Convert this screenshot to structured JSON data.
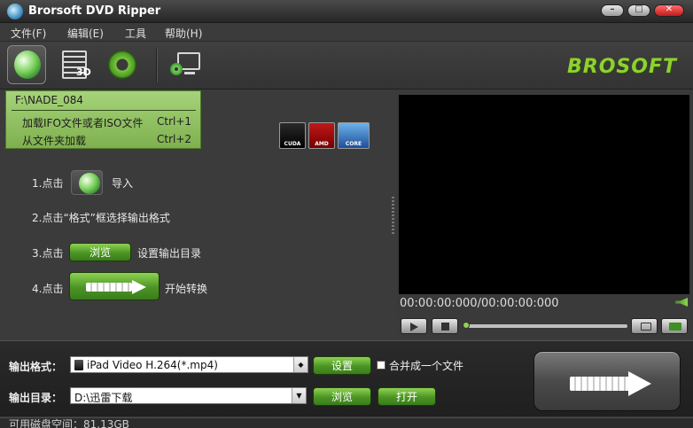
{
  "window": {
    "title": "Brorsoft DVD Ripper",
    "minimize_glyph": "–",
    "maximize_glyph": "□",
    "close_glyph": "✕"
  },
  "menu": {
    "items": [
      "文件(F)",
      "编辑(E)",
      "工具",
      "帮助(H)"
    ]
  },
  "toolbar": {
    "brand_logo_text": "BROSOFT",
    "icons": [
      "load-disc-icon",
      "edit-3d-icon",
      "settings-gear-icon",
      "display-icon"
    ],
    "badge_3d": "3D"
  },
  "load_menu": {
    "path": "F:\\NADE_084",
    "items": [
      {
        "label": "加载IFO文件或者ISO文件",
        "shortcut": "Ctrl+1"
      },
      {
        "label": "从文件夹加载",
        "shortcut": "Ctrl+2"
      }
    ]
  },
  "hw_accel": {
    "cuda": "CUDA",
    "amd": "AMD",
    "intel": "CORE"
  },
  "steps": {
    "s1_prefix": "1.点击",
    "s1_suffix": "导入",
    "s2": "2.点击“格式”框选择输出格式",
    "s3_prefix": "3.点击",
    "s3_button": "浏览",
    "s3_suffix": "设置输出目录",
    "s4_prefix": "4.点击",
    "s4_suffix": "开始转换"
  },
  "player": {
    "timecode": "00:00:00:000/00:00:00:000",
    "progress": 0
  },
  "output": {
    "format_label": "输出格式：",
    "format_value": "iPad Video H.264(*.mp4)",
    "settings_button": "设置",
    "merge_label": "合并成一个文件",
    "merge_checked": false,
    "dir_label": "输出目录：",
    "dir_value": "D:\\迅雷下载",
    "browse_button": "浏览",
    "open_button": "打开"
  },
  "status": {
    "free_space": "可用磁盘空间：81.13GB"
  },
  "colors": {
    "accent_green": "#4b9524",
    "popup_green": "#a6d37a",
    "background": "#3a3a3a"
  }
}
